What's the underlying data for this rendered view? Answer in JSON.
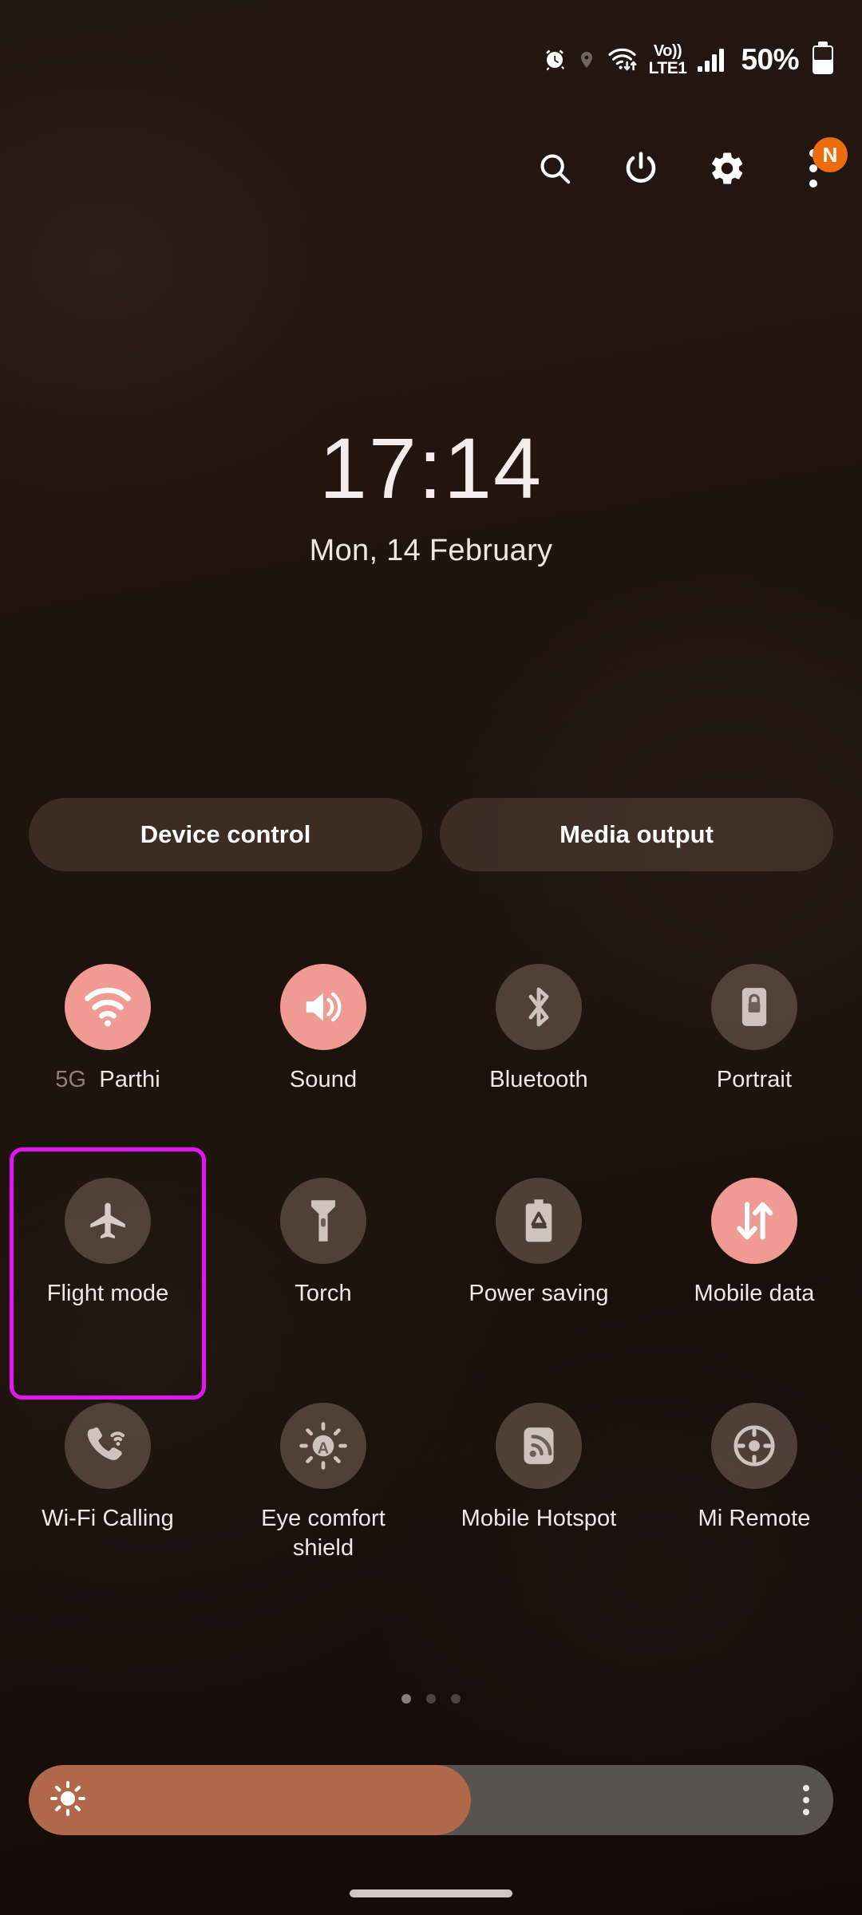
{
  "status_bar": {
    "icons": [
      "alarm-icon",
      "location-icon",
      "wifi-data-icon",
      "volte-icon",
      "signal-bars-icon"
    ],
    "volte_line1": "Vo))",
    "volte_line2": "LTE1",
    "battery_percent": "50%"
  },
  "header": {
    "buttons": [
      {
        "name": "search-button",
        "icon": "search-icon"
      },
      {
        "name": "power-button",
        "icon": "power-icon"
      },
      {
        "name": "settings-button",
        "icon": "gear-icon"
      },
      {
        "name": "more-options-button",
        "icon": "three-dots-icon"
      }
    ],
    "badge_label": "N"
  },
  "clock": {
    "time": "17:14",
    "date": "Mon, 14 February"
  },
  "pills": [
    {
      "label": "Device control"
    },
    {
      "label": "Media output"
    }
  ],
  "tiles": [
    [
      {
        "label": "Parthi",
        "prefix": "5G",
        "icon": "wifi-icon",
        "active": true,
        "selected": false
      },
      {
        "label": "Sound",
        "icon": "volume-icon",
        "active": true,
        "selected": false
      },
      {
        "label": "Bluetooth",
        "icon": "bluetooth-icon",
        "active": false,
        "selected": false
      },
      {
        "label": "Portrait",
        "icon": "rotation-lock-icon",
        "active": false,
        "selected": false
      }
    ],
    [
      {
        "label": "Flight mode",
        "icon": "airplane-icon",
        "active": false,
        "selected": true
      },
      {
        "label": "Torch",
        "icon": "flashlight-icon",
        "active": false,
        "selected": false
      },
      {
        "label": "Power saving",
        "icon": "power-saving-icon",
        "active": false,
        "selected": false
      },
      {
        "label": "Mobile data",
        "icon": "mobile-data-icon",
        "active": true,
        "selected": false
      }
    ],
    [
      {
        "label": "Wi-Fi Calling",
        "icon": "wifi-calling-icon",
        "active": false,
        "selected": false
      },
      {
        "label": "Eye comfort shield",
        "icon": "eye-comfort-icon",
        "active": false,
        "selected": false
      },
      {
        "label": "Mobile Hotspot",
        "icon": "hotspot-icon",
        "active": false,
        "selected": false
      },
      {
        "label": "Mi Remote",
        "icon": "remote-icon",
        "active": false,
        "selected": false
      }
    ]
  ],
  "pagination": {
    "total": 3,
    "current": 1
  },
  "brightness": {
    "fill_percent": 55,
    "icon": "brightness-sun-icon",
    "menu_icon": "three-dots-vertical-icon"
  },
  "colors": {
    "accent_active": "#ef9a93",
    "selection_border": "#e315f5",
    "slider_fill": "#b0684b",
    "slider_track": "#57534f",
    "badge": "#ee6c10"
  }
}
